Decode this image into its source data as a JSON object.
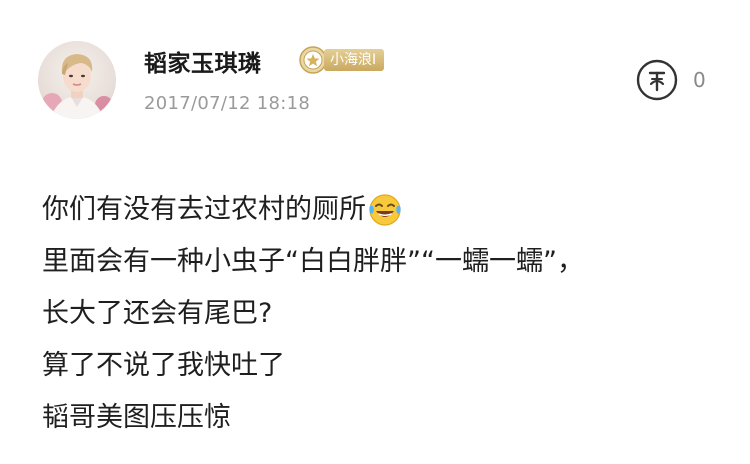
{
  "post": {
    "author": {
      "name": "韬家玉琪璘",
      "badge_label": "小海浪Ⅰ",
      "avatar_icon": "avatar-photo"
    },
    "timestamp": "2017/07/12 18:18",
    "reward": {
      "icon": "reward-icon",
      "count": "0"
    },
    "content": {
      "lines": [
        "你们有没有去过农村的厕所",
        "里面会有一种小虫子“白白胖胖”“一蠕一蠕”，",
        "长大了还会有尾巴?",
        "算了不说了我快吐了",
        "韬哥美图压压惊"
      ],
      "emoji": "laughing-crying-emoji"
    }
  },
  "colors": {
    "badge_gold": "#caa95f",
    "timestamp_gray": "#9a9a9a",
    "text": "#1f1f1f"
  }
}
